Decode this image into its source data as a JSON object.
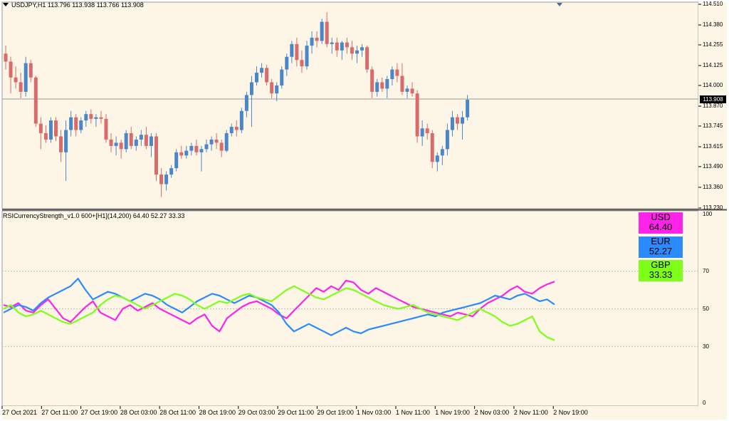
{
  "chart": {
    "title": "USDJPY,H1  113.796 113.938 113.766 113.908",
    "current_price": "113.908",
    "price_axis": [
      "114.510",
      "114.380",
      "114.255",
      "114.125",
      "114.000",
      "113.870",
      "113.745",
      "113.615",
      "113.490",
      "113.360",
      "113.230"
    ],
    "time_axis": [
      "27 Oct 2021",
      "27 Oct 11:00",
      "27 Oct 19:00",
      "28 Oct 03:00",
      "28 Oct 11:00",
      "28 Oct 19:00",
      "29 Oct 03:00",
      "29 Oct 11:00",
      "29 Oct 19:00",
      "1 Nov 03:00",
      "1 Nov 11:00",
      "1 Nov 19:00",
      "2 Nov 03:00",
      "2 Nov 11:00",
      "2 Nov 19:00"
    ],
    "colors": {
      "background": "#fdf5e6",
      "bull": "#4a86c8",
      "bear": "#d96b6b",
      "grid": "#c8c0b0"
    }
  },
  "indicator": {
    "title": "RSICurrencyStrength_v1.0 600+[H1](14,200) 64.40 52.27 33.33",
    "levels_axis": [
      "100",
      "70",
      "50",
      "30",
      "0"
    ],
    "badges": [
      {
        "currency": "USD",
        "value": "64.40",
        "color": "#ff22e8"
      },
      {
        "currency": "EUR",
        "value": "52.27",
        "color": "#2a8bff"
      },
      {
        "currency": "GBP",
        "value": "33.33",
        "color": "#7dff18"
      }
    ]
  },
  "chart_data": [
    {
      "type": "candlestick",
      "title": "USDJPY,H1",
      "ylim": [
        113.23,
        114.52
      ],
      "series": [
        {
          "name": "USDJPY,H1",
          "close_last": 113.908
        }
      ],
      "candles": [
        [
          114.2,
          114.25,
          114.1,
          114.15
        ],
        [
          114.15,
          114.18,
          113.95,
          114.05
        ],
        [
          114.05,
          114.12,
          113.98,
          114.02
        ],
        [
          114.02,
          114.08,
          113.92,
          113.96
        ],
        [
          113.96,
          114.18,
          113.93,
          114.14
        ],
        [
          114.14,
          114.16,
          114.02,
          114.05
        ],
        [
          114.05,
          114.06,
          113.74,
          113.76
        ],
        [
          113.76,
          113.8,
          113.6,
          113.7
        ],
        [
          113.7,
          113.75,
          113.64,
          113.66
        ],
        [
          113.66,
          113.8,
          113.64,
          113.78
        ],
        [
          113.78,
          113.8,
          113.65,
          113.68
        ],
        [
          113.68,
          113.72,
          113.52,
          113.58
        ],
        [
          113.58,
          113.78,
          113.4,
          113.72
        ],
        [
          113.72,
          113.84,
          113.68,
          113.8
        ],
        [
          113.8,
          113.82,
          113.68,
          113.72
        ],
        [
          113.72,
          113.8,
          113.7,
          113.78
        ],
        [
          113.78,
          113.84,
          113.74,
          113.82
        ],
        [
          113.82,
          113.85,
          113.76,
          113.79
        ],
        [
          113.79,
          113.82,
          113.74,
          113.8
        ],
        [
          113.8,
          113.84,
          113.76,
          113.79
        ],
        [
          113.79,
          113.82,
          113.64,
          113.66
        ],
        [
          113.66,
          113.7,
          113.58,
          113.62
        ],
        [
          113.62,
          113.68,
          113.56,
          113.64
        ],
        [
          113.64,
          113.66,
          113.54,
          113.6
        ],
        [
          113.6,
          113.72,
          113.58,
          113.7
        ],
        [
          113.7,
          113.74,
          113.6,
          113.62
        ],
        [
          113.62,
          113.68,
          113.59,
          113.66
        ],
        [
          113.66,
          113.72,
          113.62,
          113.69
        ],
        [
          113.69,
          113.74,
          113.6,
          113.62
        ],
        [
          113.62,
          113.7,
          113.55,
          113.68
        ],
        [
          113.68,
          113.7,
          113.4,
          113.44
        ],
        [
          113.44,
          113.48,
          113.3,
          113.38
        ],
        [
          113.38,
          113.46,
          113.34,
          113.44
        ],
        [
          113.44,
          113.5,
          113.42,
          113.48
        ],
        [
          113.48,
          113.6,
          113.46,
          113.58
        ],
        [
          113.58,
          113.62,
          113.54,
          113.56
        ],
        [
          113.56,
          113.62,
          113.54,
          113.59
        ],
        [
          113.59,
          113.64,
          113.56,
          113.62
        ],
        [
          113.62,
          113.66,
          113.56,
          113.58
        ],
        [
          113.58,
          113.62,
          113.46,
          113.6
        ],
        [
          113.6,
          113.66,
          113.58,
          113.63
        ],
        [
          113.63,
          113.68,
          113.59,
          113.66
        ],
        [
          113.66,
          113.7,
          113.6,
          113.64
        ],
        [
          113.64,
          113.66,
          113.55,
          113.59
        ],
        [
          113.59,
          113.72,
          113.58,
          113.7
        ],
        [
          113.7,
          113.76,
          113.68,
          113.74
        ],
        [
          113.74,
          113.78,
          113.68,
          113.72
        ],
        [
          113.72,
          113.86,
          113.7,
          113.84
        ],
        [
          113.84,
          113.96,
          113.8,
          113.94
        ],
        [
          113.94,
          114.06,
          113.74,
          114.02
        ],
        [
          114.02,
          114.12,
          114.0,
          114.08
        ],
        [
          114.08,
          114.14,
          114.05,
          114.11
        ],
        [
          114.11,
          114.13,
          114.0,
          114.02
        ],
        [
          114.02,
          114.04,
          113.92,
          113.95
        ],
        [
          113.95,
          114.02,
          113.9,
          114.0
        ],
        [
          114.0,
          114.12,
          113.98,
          114.1
        ],
        [
          114.1,
          114.2,
          114.06,
          114.18
        ],
        [
          114.18,
          114.28,
          114.14,
          114.26
        ],
        [
          114.26,
          114.3,
          114.12,
          114.16
        ],
        [
          114.16,
          114.22,
          114.08,
          114.12
        ],
        [
          114.12,
          114.28,
          114.1,
          114.25
        ],
        [
          114.25,
          114.34,
          114.2,
          114.3
        ],
        [
          114.3,
          114.34,
          114.24,
          114.28
        ],
        [
          114.28,
          114.42,
          114.26,
          114.4
        ],
        [
          114.4,
          114.46,
          114.24,
          114.26
        ],
        [
          114.26,
          114.3,
          114.2,
          114.27
        ],
        [
          114.27,
          114.3,
          114.18,
          114.22
        ],
        [
          114.22,
          114.28,
          114.16,
          114.27
        ],
        [
          114.27,
          114.3,
          114.2,
          114.24
        ],
        [
          114.24,
          114.28,
          114.16,
          114.2
        ],
        [
          114.2,
          114.25,
          114.14,
          114.22
        ],
        [
          114.22,
          114.26,
          114.18,
          114.24
        ],
        [
          114.24,
          114.25,
          114.08,
          114.1
        ],
        [
          114.1,
          114.12,
          113.92,
          113.96
        ],
        [
          113.96,
          114.04,
          113.93,
          114.02
        ],
        [
          114.02,
          114.05,
          113.96,
          113.98
        ],
        [
          113.98,
          114.06,
          113.92,
          114.04
        ],
        [
          114.04,
          114.12,
          114.0,
          114.1
        ],
        [
          114.1,
          114.14,
          114.02,
          114.06
        ],
        [
          114.06,
          114.14,
          113.94,
          113.96
        ],
        [
          113.96,
          114.0,
          113.92,
          113.98
        ],
        [
          113.98,
          114.02,
          113.93,
          113.95
        ],
        [
          113.95,
          113.97,
          113.64,
          113.68
        ],
        [
          113.68,
          113.78,
          113.62,
          113.73
        ],
        [
          113.73,
          113.76,
          113.66,
          113.7
        ],
        [
          113.7,
          113.72,
          113.48,
          113.52
        ],
        [
          113.52,
          113.58,
          113.46,
          113.56
        ],
        [
          113.56,
          113.62,
          113.5,
          113.6
        ],
        [
          113.6,
          113.76,
          113.56,
          113.72
        ],
        [
          113.72,
          113.84,
          113.68,
          113.8
        ],
        [
          113.8,
          113.82,
          113.72,
          113.76
        ],
        [
          113.76,
          113.84,
          113.66,
          113.8
        ],
        [
          113.8,
          113.94,
          113.78,
          113.91
        ]
      ]
    },
    {
      "type": "line",
      "title": "RSICurrencyStrength_v1.0 600+[H1](14,200)",
      "ylim": [
        0,
        100
      ],
      "levels": [
        30,
        50,
        70
      ],
      "x": [
        "27 Oct 2021",
        "27 Oct 11:00",
        "27 Oct 19:00",
        "28 Oct 03:00",
        "28 Oct 11:00",
        "28 Oct 19:00",
        "29 Oct 03:00",
        "29 Oct 11:00",
        "29 Oct 19:00",
        "1 Nov 03:00",
        "1 Nov 11:00",
        "1 Nov 19:00",
        "2 Nov 03:00",
        "2 Nov 11:00",
        "2 Nov 19:00"
      ],
      "series": [
        {
          "name": "USD",
          "color": "#ff22e8",
          "values": [
            52,
            51,
            53,
            49,
            48,
            52,
            55,
            50,
            45,
            43,
            47,
            51,
            54,
            48,
            46,
            44,
            50,
            52,
            49,
            51,
            53,
            50,
            48,
            46,
            44,
            42,
            45,
            47,
            41,
            38,
            45,
            48,
            51,
            53,
            54,
            52,
            50,
            47,
            45,
            49,
            53,
            57,
            61,
            59,
            62,
            60,
            65,
            64,
            60,
            58,
            61,
            59,
            57,
            55,
            53,
            51,
            50,
            49,
            48,
            47,
            46,
            48,
            47,
            46,
            50,
            53,
            55,
            57,
            60,
            62,
            59,
            58,
            61,
            63,
            64.4
          ]
        },
        {
          "name": "EUR",
          "color": "#2a8bff",
          "values": [
            48,
            50,
            52,
            51,
            49,
            53,
            56,
            58,
            60,
            62,
            66,
            60,
            55,
            57,
            59,
            58,
            56,
            54,
            56,
            58,
            57,
            55,
            52,
            50,
            48,
            51,
            54,
            56,
            58,
            57,
            55,
            53,
            55,
            57,
            56,
            54,
            52,
            48,
            42,
            38,
            40,
            42,
            40,
            38,
            36,
            38,
            40,
            38,
            37,
            39,
            40,
            41,
            42,
            43,
            44,
            45,
            46,
            47,
            46,
            48,
            49,
            50,
            51,
            52,
            53,
            55,
            57,
            56,
            55,
            57,
            58,
            56,
            54,
            55,
            52.27
          ]
        },
        {
          "name": "GBP",
          "color": "#7dff18",
          "values": [
            50,
            52,
            48,
            46,
            47,
            49,
            47,
            45,
            43,
            42,
            44,
            46,
            48,
            52,
            55,
            57,
            56,
            54,
            52,
            50,
            52,
            54,
            56,
            58,
            57,
            55,
            52,
            50,
            52,
            54,
            53,
            55,
            57,
            58,
            56,
            55,
            54,
            57,
            60,
            62,
            60,
            58,
            56,
            55,
            57,
            59,
            61,
            60,
            58,
            56,
            54,
            52,
            51,
            50,
            51,
            52,
            50,
            48,
            47,
            46,
            45,
            44,
            46,
            48,
            50,
            48,
            46,
            43,
            41,
            42,
            44,
            46,
            38,
            35,
            33.33
          ]
        }
      ]
    }
  ]
}
